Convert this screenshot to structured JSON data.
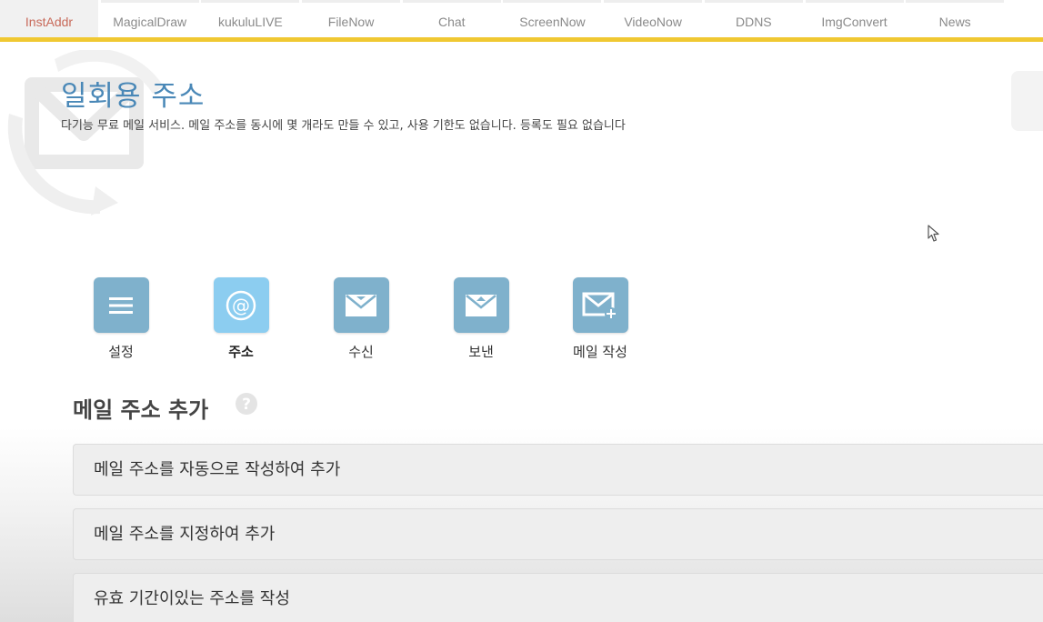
{
  "nav": {
    "tabs": [
      {
        "label": "InstAddr",
        "active": true
      },
      {
        "label": "MagicalDraw",
        "active": false
      },
      {
        "label": "kukuluLIVE",
        "active": false
      },
      {
        "label": "FileNow",
        "active": false
      },
      {
        "label": "Chat",
        "active": false
      },
      {
        "label": "ScreenNow",
        "active": false
      },
      {
        "label": "VideoNow",
        "active": false
      },
      {
        "label": "DDNS",
        "active": false
      },
      {
        "label": "ImgConvert",
        "active": false
      },
      {
        "label": "News",
        "active": false
      }
    ],
    "accent_color": "#f0c832",
    "active_text_color": "#c86a5a"
  },
  "header": {
    "title": "일회용 주소",
    "subtitle": "다기능 무료 메일 서비스. 메일 주소를 동시에 몇 개라도 만들 수 있고, 사용 기한도 없습니다. 등록도 필요 없습니다",
    "title_color": "#4a88b7"
  },
  "menu": {
    "items": [
      {
        "label": "설정",
        "icon": "hamburger-icon",
        "active": false
      },
      {
        "label": "주소",
        "icon": "at-sign-icon",
        "active": true
      },
      {
        "label": "수신",
        "icon": "inbox-mail-icon",
        "active": false
      },
      {
        "label": "보낸",
        "icon": "sent-mail-icon",
        "active": false
      },
      {
        "label": "메일 작성",
        "icon": "compose-mail-icon",
        "active": false
      }
    ],
    "icon_color": "#7fb1cc",
    "active_icon_color": "#8ccdf0"
  },
  "section": {
    "title": "메일 주소 추가",
    "help_icon": "question-mark-icon"
  },
  "actions": [
    {
      "label": "메일 주소를 자동으로 작성하여 추가"
    },
    {
      "label": "메일 주소를 지정하여 추가"
    },
    {
      "label": "유효 기간이있는 주소를 작성"
    }
  ]
}
